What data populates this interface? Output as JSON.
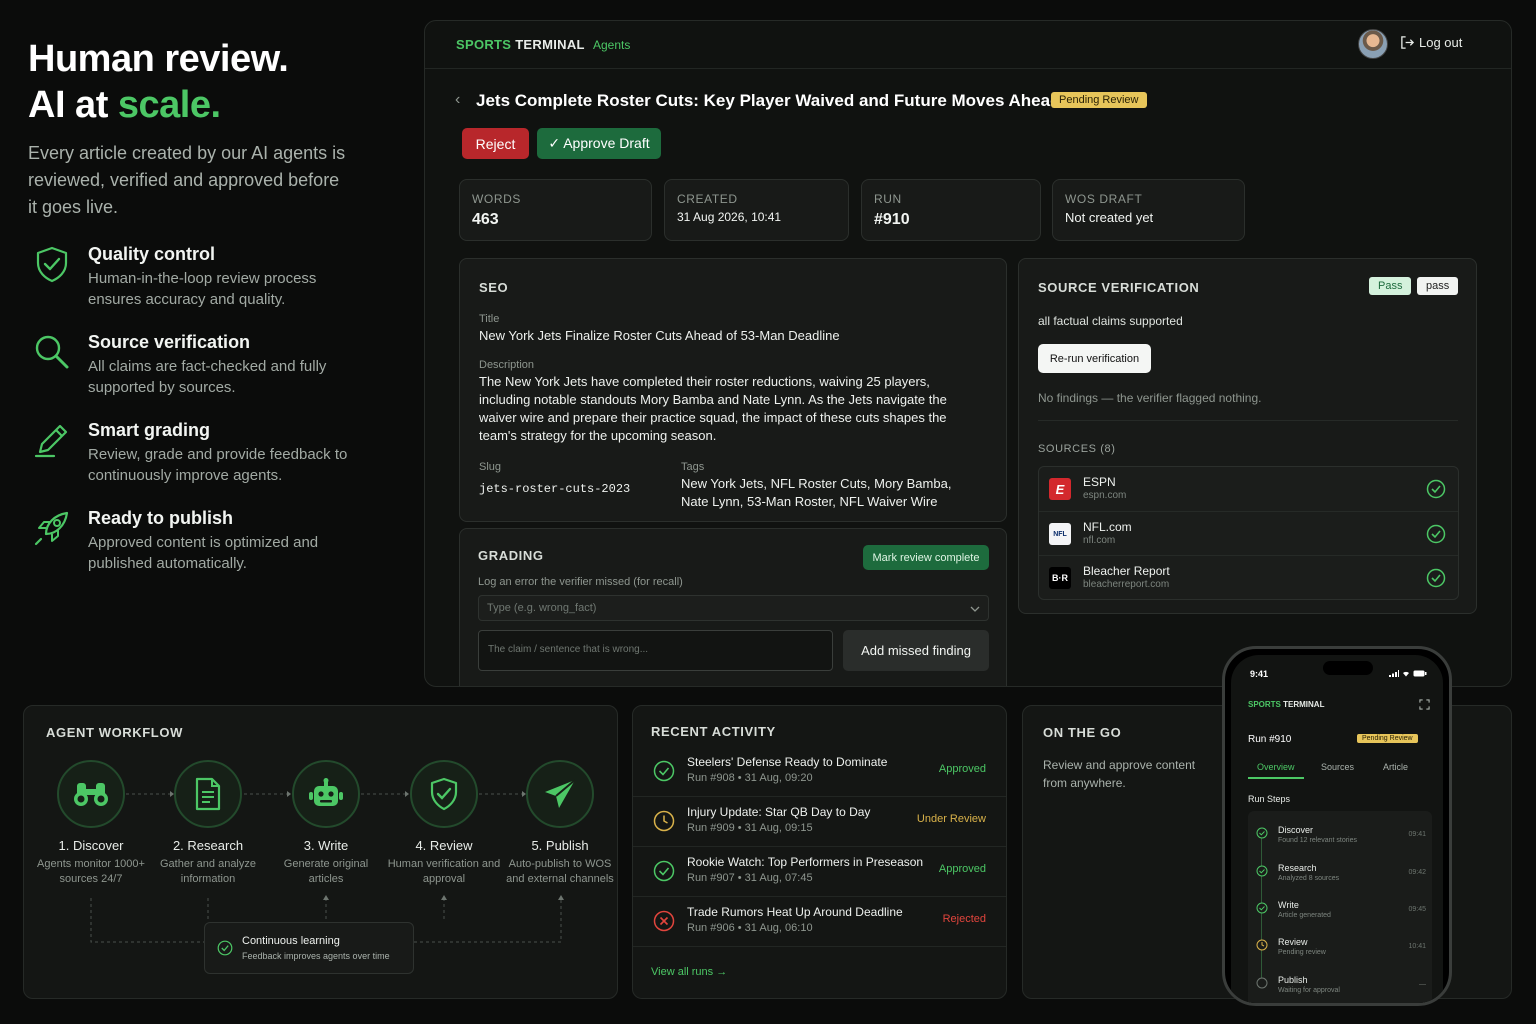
{
  "hero": {
    "title_line1": "Human review.",
    "title_line2_a": "AI at ",
    "title_line2_b": "scale.",
    "subtitle": "Every article created by our AI agents is reviewed, verified and approved before it goes live.",
    "features": [
      {
        "icon": "shield-check-icon",
        "title": "Quality control",
        "desc": "Human-in-the-loop review process ensures accuracy and quality."
      },
      {
        "icon": "search-icon",
        "title": "Source verification",
        "desc": "All claims are fact-checked and fully supported by sources."
      },
      {
        "icon": "pencil-icon",
        "title": "Smart grading",
        "desc": "Review, grade and provide feedback to continuously improve agents."
      },
      {
        "icon": "rocket-icon",
        "title": "Ready to publish",
        "desc": "Approved content is optimized and published automatically."
      }
    ]
  },
  "terminal": {
    "brand_a": "SPORTS",
    "brand_b": "TERMINAL",
    "nav_agents": "Agents",
    "logout": "Log out",
    "article_title": "Jets Complete Roster Cuts: Key Player Waived and Future Moves Ahead",
    "status_badge": "Pending Review",
    "reject": "Reject",
    "approve": "✓ Approve Draft",
    "stats": [
      {
        "k": "WORDS",
        "v": "463"
      },
      {
        "k": "CREATED",
        "v": "31 Aug 2026, 10:41"
      },
      {
        "k": "RUN",
        "v": "#910"
      },
      {
        "k": "WOS DRAFT",
        "v": "Not created yet"
      }
    ],
    "seo": {
      "heading": "SEO",
      "title_label": "Title",
      "title": "New York Jets Finalize Roster Cuts Ahead of 53-Man Deadline",
      "desc_label": "Description",
      "desc": "The New York Jets have completed their roster reductions, waiving 25 players, including notable standouts Mory Bamba and Nate Lynn. As the Jets navigate the waiver wire and prepare their practice squad, the impact of these cuts shapes the team's strategy for the upcoming season.",
      "slug_label": "Slug",
      "slug": "jets-roster-cuts-2023",
      "tags_label": "Tags",
      "tags": "New York Jets, NFL Roster Cuts, Mory Bamba, Nate Lynn, 53-Man Roster, NFL Waiver Wire"
    },
    "grading": {
      "heading": "GRADING",
      "mark_complete": "Mark review complete",
      "log_label": "Log an error the verifier missed (for recall)",
      "type_placeholder": "Type (e.g. wrong_fact)",
      "claim_placeholder": "The claim / sentence that is wrong...",
      "add_button": "Add missed finding"
    },
    "verification": {
      "heading": "SOURCE VERIFICATION",
      "badge_pass1": "Pass",
      "badge_pass2": "pass",
      "summary": "all factual claims supported",
      "rerun": "Re-run verification",
      "no_findings": "No findings — the verifier flagged nothing.",
      "sources_label": "SOURCES (8)",
      "sources": [
        {
          "name": "ESPN",
          "domain": "espn.com",
          "logo": "E"
        },
        {
          "name": "NFL.com",
          "domain": "nfl.com",
          "logo": "NFL"
        },
        {
          "name": "Bleacher Report",
          "domain": "bleacherreport.com",
          "logo": "B·R"
        }
      ]
    }
  },
  "workflow": {
    "heading": "AGENT WORKFLOW",
    "steps": [
      {
        "icon": "binoculars-icon",
        "name": "1. Discover",
        "desc": "Agents monitor 1000+ sources 24/7"
      },
      {
        "icon": "document-icon",
        "name": "2. Research",
        "desc": "Gather and analyze information"
      },
      {
        "icon": "robot-icon",
        "name": "3. Write",
        "desc": "Generate original articles"
      },
      {
        "icon": "shield-check-icon",
        "name": "4. Review",
        "desc": "Human verification and approval"
      },
      {
        "icon": "paper-plane-icon",
        "name": "5. Publish",
        "desc": "Auto-publish to WOS and external channels"
      }
    ],
    "learning_title": "Continuous learning",
    "learning_desc": "Feedback improves agents over time"
  },
  "activity": {
    "heading": "RECENT ACTIVITY",
    "items": [
      {
        "title": "Steelers' Defense Ready to Dominate",
        "meta": "Run #908 • 31 Aug, 09:20",
        "status": "Approved",
        "kind": "approved"
      },
      {
        "title": "Injury Update: Star QB Day to Day",
        "meta": "Run #909 • 31 Aug, 09:15",
        "status": "Under Review",
        "kind": "review"
      },
      {
        "title": "Rookie Watch: Top Performers in Preseason",
        "meta": "Run #907 • 31 Aug, 07:45",
        "status": "Approved",
        "kind": "approved"
      },
      {
        "title": "Trade Rumors Heat Up Around Deadline",
        "meta": "Run #906 • 31 Aug, 06:10",
        "status": "Rejected",
        "kind": "rejected"
      }
    ],
    "view_all": "View all runs →"
  },
  "onthego": {
    "heading": "ON THE GO",
    "desc": "Review and approve content from anywhere."
  },
  "phone": {
    "time": "9:41",
    "brand_a": "SPORTS",
    "brand_b": "TERMINAL",
    "run": "Run #910",
    "badge": "Pending Review",
    "tabs": [
      "Overview",
      "Sources",
      "Article"
    ],
    "steps_heading": "Run Steps",
    "steps": [
      {
        "name": "Discover",
        "sub": "Found 12 relevant stories",
        "time": "09:41",
        "state": "done"
      },
      {
        "name": "Research",
        "sub": "Analyzed 8 sources",
        "time": "09:42",
        "state": "done"
      },
      {
        "name": "Write",
        "sub": "Article generated",
        "time": "09:45",
        "state": "done"
      },
      {
        "name": "Review",
        "sub": "Pending review",
        "time": "10:41",
        "state": "pending"
      },
      {
        "name": "Publish",
        "sub": "Waiting for approval",
        "time": "—",
        "state": "todo"
      }
    ]
  },
  "colors": {
    "accent": "#4cc765",
    "reject": "#b8272b",
    "approve": "#1d6b3d",
    "pending": "#d9b24a",
    "rejected_text": "#e2453d"
  }
}
